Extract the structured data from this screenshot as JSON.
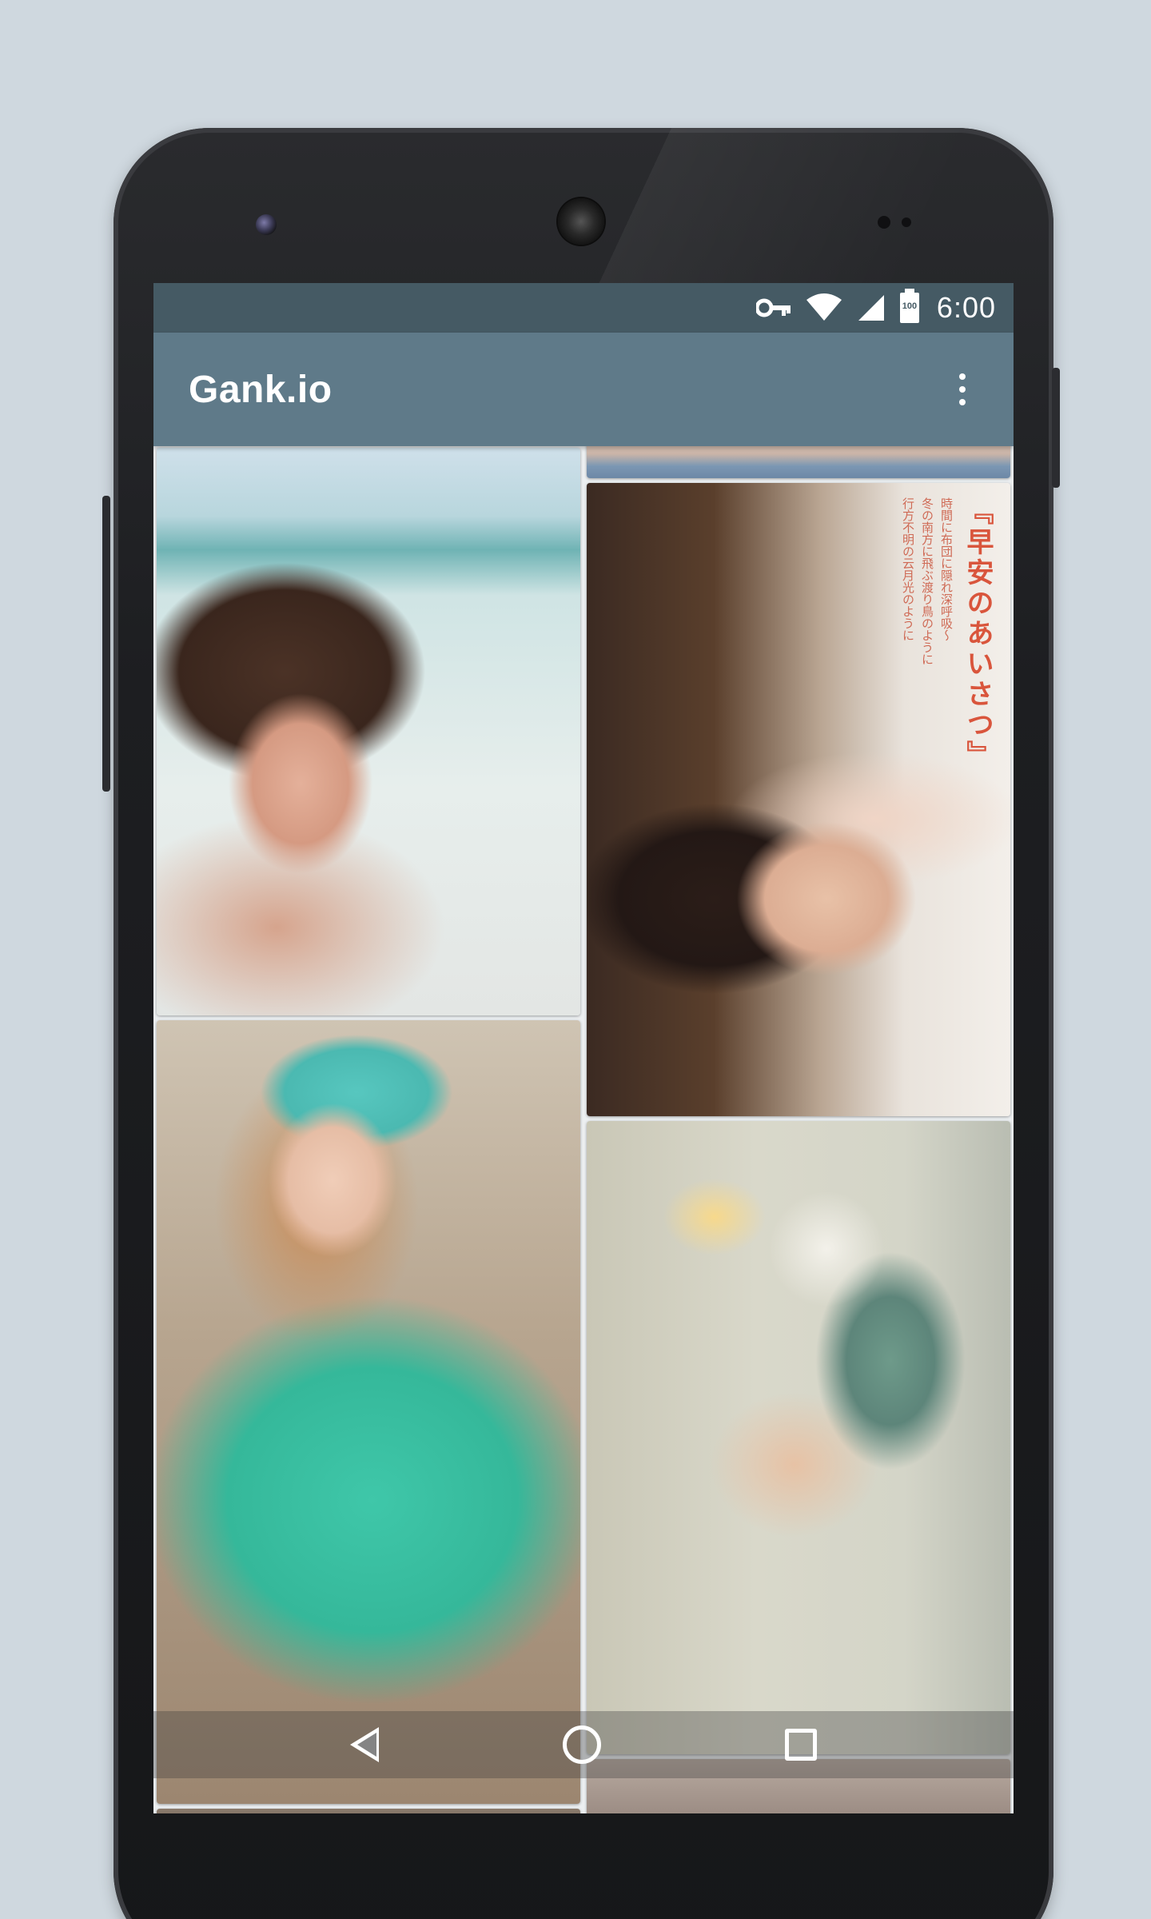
{
  "status_bar": {
    "time": "6:00",
    "battery_text": "100",
    "icons": [
      "vpn-key-icon",
      "wifi-icon",
      "cell-signal-icon",
      "battery-icon"
    ]
  },
  "app_bar": {
    "title": "Gank.io",
    "overflow_icon": "more-vert-icon"
  },
  "photo_overlay_text": {
    "title": "『早安のあいさつ』",
    "line1": "時間に布団に隠れ深呼吸〜",
    "line2": "冬の南方に飛ぶ渡り鳥のように",
    "line3": "行方不明の云月光のように"
  },
  "nav_bar": {
    "icons": [
      "back-icon",
      "home-icon",
      "recents-icon"
    ]
  },
  "colors": {
    "status_bar": "#455a64",
    "app_bar": "#5f7a89",
    "background": "#cfd8df"
  }
}
